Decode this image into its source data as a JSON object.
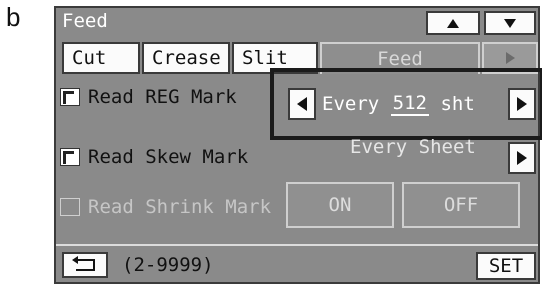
{
  "figure_label": "b",
  "screen": {
    "title": "Feed",
    "tabs": [
      {
        "label": "Cut",
        "state": "unselected"
      },
      {
        "label": "Crease",
        "state": "unselected"
      },
      {
        "label": "Slit",
        "state": "unselected"
      },
      {
        "label": "Feed",
        "state": "selected"
      }
    ],
    "rows": {
      "reg_mark": {
        "label": "Read REG Mark",
        "checked": true,
        "value_prefix": "Every",
        "value": "512",
        "value_suffix": "sht"
      },
      "skew_mark": {
        "label": "Read Skew Mark",
        "checked": true,
        "value": "Every Sheet"
      },
      "shrink_mark": {
        "label": "Read Shrink Mark",
        "checked": false,
        "on_label": "ON",
        "off_label": "OFF"
      }
    },
    "range_text": "(2-9999)",
    "set_label": "SET",
    "icons": [
      "scroll-up-icon",
      "scroll-down-icon",
      "tab-next-icon",
      "decrease-arrow-icon",
      "increase-arrow-icon",
      "skew-next-icon",
      "back-return-icon"
    ]
  }
}
